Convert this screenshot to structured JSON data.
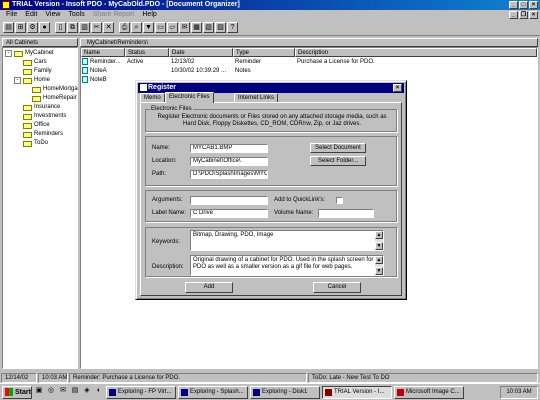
{
  "app": {
    "title": "TRIAL Version - Insoft PDO - MyCabOld.PDO - [Document Organizer]",
    "menu": [
      "File",
      "Edit",
      "View",
      "Tools",
      "Share Report",
      "Help"
    ],
    "menu_disabled": [
      false,
      false,
      false,
      false,
      true,
      false
    ]
  },
  "tree": {
    "header": "All Cabinets",
    "nodes": [
      {
        "label": "MyCabinet",
        "expander": "-"
      },
      {
        "label": "Cars",
        "expander": ""
      },
      {
        "label": "Family",
        "expander": ""
      },
      {
        "label": "Home",
        "expander": "-"
      },
      {
        "label": "HomeMortga",
        "expander": ""
      },
      {
        "label": "HomeRepair",
        "expander": ""
      },
      {
        "label": "Insurance",
        "expander": ""
      },
      {
        "label": "Investments",
        "expander": ""
      },
      {
        "label": "Office",
        "expander": ""
      },
      {
        "label": "Reminders",
        "expander": ""
      },
      {
        "label": "ToDo",
        "expander": ""
      }
    ]
  },
  "list": {
    "path": "MyCabinet\\Reminders\\",
    "columns": [
      "Name",
      "Status",
      "Date",
      "Type",
      "Description"
    ],
    "rows": [
      [
        "Reminder...",
        "Active",
        "12/13/02",
        "Reminder",
        "Purchase a License for PDO."
      ],
      [
        "NoteA",
        "",
        "10/30/02 10:39:29 ...",
        "Notes",
        ""
      ],
      [
        "NoteB",
        "",
        "",
        "",
        ""
      ]
    ]
  },
  "dialog": {
    "title": "Register",
    "tabs": [
      "Memo",
      "Electronic Files",
      "Internet Links"
    ],
    "active_tab": 1,
    "group_label": "Electronic Files",
    "instructions": "Register Electronic documents or Files stored on any attached storage media, such as Hard Disk, Floppy Diskettes, CD_ROM, CDR/rw, Zip, or Jaz drives.",
    "name_label": "Name:",
    "name_value": "MYCAB1.BMP",
    "location_label": "Location:",
    "location_value": "MyCabinet\\Office\\",
    "path_label": "Path:",
    "path_value": "D:\\PDO\\SplashImages\\MYCA",
    "select_document": "Select Document",
    "select_folder": "Select Folder...",
    "arguments_label": "Arguments:",
    "arguments_value": "",
    "quicklink_label": "Add to QuickLink's:",
    "label_name_label": "Label Name:",
    "label_name_value": "C Drive",
    "volume_name_label": "Volume Name:",
    "volume_name_value": "",
    "keywords_label": "Keywords:",
    "keywords_value": "Bitmap, Drawing, PDO, Image",
    "description_label": "Description:",
    "description_value": "Original drawing of a cabinet for PDO.  Used in the splash screen for PDO as well as a smaller version as a gif file for web pages.",
    "add_button": "Add",
    "cancel_button": "Cancel"
  },
  "status": {
    "date": "12/14/02",
    "time": "10:03 AM",
    "reminder": "Reminder: Purchase a License for PDO.",
    "todo": "ToDo: Late - New Test To DO"
  },
  "taskbar": {
    "start": "Start",
    "tasks": [
      {
        "label": "Exploring - FP Virt...",
        "active": false
      },
      {
        "label": "Exploring - Splash...",
        "active": false
      },
      {
        "label": "Exploring - Disk1",
        "active": false
      },
      {
        "label": "TRIAL Version - I...",
        "active": true
      },
      {
        "label": "Microsoft Image C...",
        "active": false
      }
    ],
    "clock": "10:03 AM"
  },
  "colors": {
    "title_active": "#000080",
    "desktop": "#008080",
    "face": "#c0c0c0"
  }
}
